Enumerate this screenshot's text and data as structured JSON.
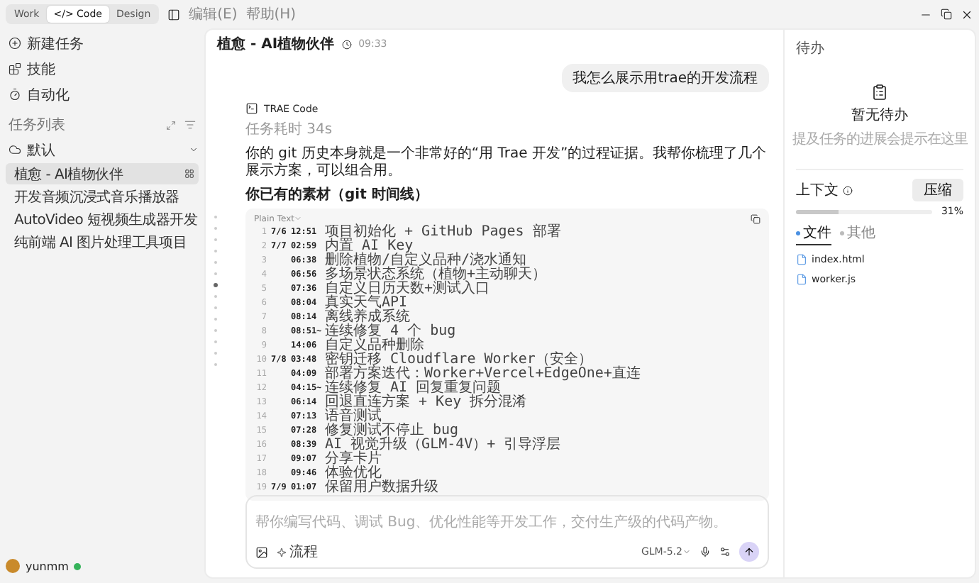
{
  "titlebar": {
    "modes": [
      {
        "label": "Work",
        "selected": false
      },
      {
        "label": "</> Code",
        "selected": true
      },
      {
        "label": "Design",
        "selected": false
      }
    ],
    "menu": [
      "编辑(E)",
      "帮助(H)"
    ]
  },
  "sidebar": {
    "actions": [
      "新建任务",
      "技能",
      "自动化"
    ],
    "section_title": "任务列表",
    "group": {
      "label": "默认",
      "expanded": true
    },
    "items": [
      {
        "label": "植愈 - AI植物伙伴",
        "selected": true
      },
      {
        "label": "开发音频沉浸式音乐播放器",
        "selected": false
      },
      {
        "label": "AutoVideo 短视频生成器开发",
        "selected": false
      },
      {
        "label": "纯前端 AI 图片处理工具项目",
        "selected": false
      }
    ],
    "user": {
      "name": "yunmm",
      "online": true
    }
  },
  "chat": {
    "title": "植愈 - AI植物伙伴",
    "time": "09:33",
    "user_message": "我怎么展示用trae的开发流程",
    "assistant": {
      "name": "TRAE Code",
      "duration": "任务耗时 34s",
      "paragraph": "你的 git 历史本身就是一个非常好的“用 Trae 开发”的过程证据。我帮你梳理了几个展示方案，可以组合用。",
      "heading": "你已有的素材（git 时间线）",
      "code": {
        "language": "Plain Text",
        "lines": [
          {
            "num": "1",
            "date": "7/6",
            "time": "12:51",
            "text": "项目初始化 + GitHub Pages 部署"
          },
          {
            "num": "2",
            "date": "7/7",
            "time": "02:59",
            "text": "内置 AI Key"
          },
          {
            "num": "3",
            "time": "06:38",
            "text": "删除植物/自定义品种/浇水通知"
          },
          {
            "num": "4",
            "time": "06:56",
            "text": "多场景状态系统（植物+主动聊天）"
          },
          {
            "num": "5",
            "time": "07:36",
            "text": "自定义日历天数+测试入口"
          },
          {
            "num": "6",
            "time": "08:04",
            "text": "真实天气API"
          },
          {
            "num": "7",
            "time": "08:14",
            "text": "离线养成系统"
          },
          {
            "num": "8",
            "time": "08:51~",
            "text": "连续修复 4 个 bug"
          },
          {
            "num": "9",
            "time": "14:06",
            "text": "自定义品种删除"
          },
          {
            "num": "10",
            "date": "7/8",
            "time": "03:48",
            "text": "密钥迁移 Cloudflare Worker（安全）"
          },
          {
            "num": "11",
            "time": "04:09",
            "text": "部署方案迭代：Worker+Vercel+EdgeOne+直连"
          },
          {
            "num": "12",
            "time": "04:15~",
            "text": "连续修复 AI 回复重复问题"
          },
          {
            "num": "13",
            "time": "06:14",
            "text": "回退直连方案 + Key 拆分混淆"
          },
          {
            "num": "14",
            "time": "07:13",
            "text": "语音测试"
          },
          {
            "num": "15",
            "time": "07:28",
            "text": "修复测试不停止 bug"
          },
          {
            "num": "16",
            "time": "08:39",
            "text": "AI 视觉升级（GLM-4V）+ 引导浮层"
          },
          {
            "num": "17",
            "time": "09:07",
            "text": "分享卡片"
          },
          {
            "num": "18",
            "time": "09:46",
            "text": "体验优化"
          },
          {
            "num": "19",
            "date": "7/9",
            "time": "01:07",
            "text": "保留用户数据升级"
          }
        ]
      }
    }
  },
  "composer": {
    "placeholder": "帮你编写代码、调试 Bug、优化性能等开发工作，交付生产级的代码产物。",
    "mode": "流程",
    "model": "GLM-5.2"
  },
  "right_panel": {
    "todo_title": "待办",
    "empty_title": "暂无待办",
    "empty_hint": "提及任务的进展会提示在这里",
    "context": {
      "label": "上下文",
      "button": "压缩",
      "level": 0.31,
      "reading": "31%"
    },
    "tabs": [
      {
        "label": "文件",
        "selected": true
      },
      {
        "label": "其他",
        "selected": false
      }
    ],
    "files": [
      "index.html",
      "worker.js"
    ]
  }
}
